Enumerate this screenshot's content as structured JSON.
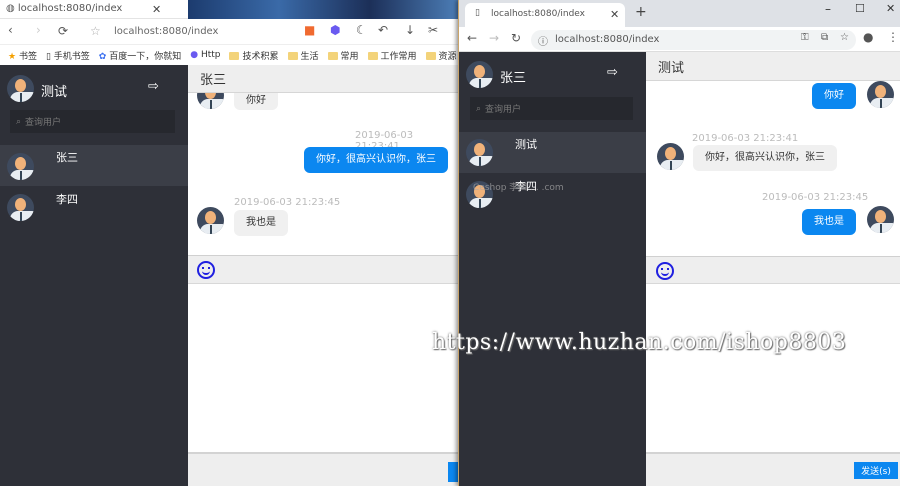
{
  "left_window": {
    "tab_title": "localhost:8080/index",
    "url": "localhost:8080/index",
    "bookmarks": [
      "书签",
      "手机书签",
      "百度一下，你就知",
      "Http",
      "技术积累",
      "生活",
      "常用",
      "工作常用",
      "资源"
    ],
    "current_user": "测试",
    "search_placeholder": "查询用户",
    "contacts": [
      {
        "name": "张三",
        "selected": true
      },
      {
        "name": "李四",
        "selected": false
      }
    ],
    "chat_title": "张三",
    "messages": [
      {
        "from": "them",
        "text": "你好",
        "time": ""
      },
      {
        "from": "me",
        "text": "你好，很高兴认识你，张三",
        "time": "2019-06-03 21:23:41"
      },
      {
        "from": "them",
        "text": "我也是",
        "time": "2019-06-03 21:23:45"
      }
    ]
  },
  "right_window": {
    "tab_title": "localhost:8080/index",
    "url": "localhost:8080/index",
    "current_user": "张三",
    "search_placeholder": "查询用户",
    "contacts": [
      {
        "name": "测试",
        "selected": true
      },
      {
        "name": "李四",
        "selected": false
      }
    ],
    "chat_title": "测试",
    "messages": [
      {
        "from": "me",
        "text": "你好",
        "time": ""
      },
      {
        "from": "them",
        "text": "你好，很高兴认识你，张三",
        "time": "2019-06-03 21:23:41"
      },
      {
        "from": "me",
        "text": "我也是",
        "time": "2019-06-03 21:23:45"
      }
    ],
    "send_label": "发送(s)"
  },
  "watermark": "https://www.huzhan.com/ishop8803",
  "sidebar_watermark": "Ceshop 李四 ... .com",
  "colors": {
    "sidebar": "#2e3038",
    "accent": "#0b87f0"
  }
}
